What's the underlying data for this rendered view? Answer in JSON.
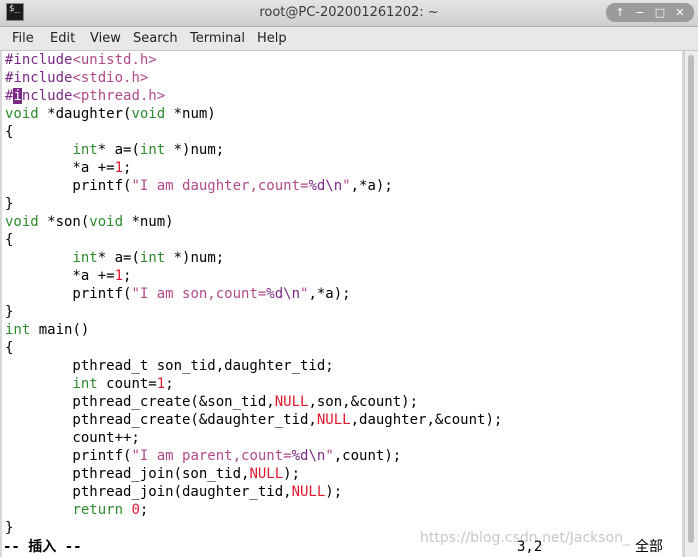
{
  "window": {
    "title": "root@PC-202001261202: ~",
    "app_icon_text": "$_",
    "controls": [
      "↑",
      "−",
      "□",
      "✕"
    ]
  },
  "menu": [
    "File",
    "Edit",
    "View",
    "Search",
    "Terminal",
    "Help"
  ],
  "code": [
    [
      [
        "pre",
        "#include"
      ],
      [
        "str",
        "<unistd.h>"
      ]
    ],
    [
      [
        "pre",
        "#include"
      ],
      [
        "str",
        "<stdio.h>"
      ]
    ],
    [
      [
        "pre",
        "#"
      ],
      [
        "cur",
        "i"
      ],
      [
        "pre",
        "nclude"
      ],
      [
        "str",
        "<pthread.h>"
      ]
    ],
    [
      [
        "kw",
        "void"
      ],
      [
        "n",
        " *daughter("
      ],
      [
        "kw",
        "void"
      ],
      [
        "n",
        " *num)"
      ]
    ],
    [
      [
        "n",
        "{"
      ]
    ],
    [
      [
        "n",
        "        "
      ],
      [
        "kw",
        "int"
      ],
      [
        "n",
        "* a=("
      ],
      [
        "kw",
        "int"
      ],
      [
        "n",
        " *)num;"
      ]
    ],
    [
      [
        "n",
        "        *a +="
      ],
      [
        "num",
        "1"
      ],
      [
        "n",
        ";"
      ]
    ],
    [
      [
        "n",
        "        printf("
      ],
      [
        "str",
        "\"I am daughter,count="
      ],
      [
        "pre",
        "%d\\n"
      ],
      [
        "str",
        "\""
      ],
      [
        "n",
        ",*a);"
      ]
    ],
    [
      [
        "n",
        "}"
      ]
    ],
    [
      [
        "kw",
        "void"
      ],
      [
        "n",
        " *son("
      ],
      [
        "kw",
        "void"
      ],
      [
        "n",
        " *num)"
      ]
    ],
    [
      [
        "n",
        "{"
      ]
    ],
    [
      [
        "n",
        "        "
      ],
      [
        "kw",
        "int"
      ],
      [
        "n",
        "* a=("
      ],
      [
        "kw",
        "int"
      ],
      [
        "n",
        " *)num;"
      ]
    ],
    [
      [
        "n",
        "        *a +="
      ],
      [
        "num",
        "1"
      ],
      [
        "n",
        ";"
      ]
    ],
    [
      [
        "n",
        "        printf("
      ],
      [
        "str",
        "\"I am son,count="
      ],
      [
        "pre",
        "%d\\n"
      ],
      [
        "str",
        "\""
      ],
      [
        "n",
        ",*a);"
      ]
    ],
    [
      [
        "n",
        "}"
      ]
    ],
    [
      [
        "kw",
        "int"
      ],
      [
        "n",
        " main()"
      ]
    ],
    [
      [
        "n",
        "{"
      ]
    ],
    [
      [
        "n",
        "        pthread_t son_tid,daughter_tid;"
      ]
    ],
    [
      [
        "n",
        "        "
      ],
      [
        "kw",
        "int"
      ],
      [
        "n",
        " count="
      ],
      [
        "num",
        "1"
      ],
      [
        "n",
        ";"
      ]
    ],
    [
      [
        "n",
        "        pthread_create(&son_tid,"
      ],
      [
        "num",
        "NULL"
      ],
      [
        "n",
        ",son,&count);"
      ]
    ],
    [
      [
        "n",
        "        pthread_create(&daughter_tid,"
      ],
      [
        "num",
        "NULL"
      ],
      [
        "n",
        ",daughter,&count);"
      ]
    ],
    [
      [
        "n",
        "        count++;"
      ]
    ],
    [
      [
        "n",
        "        printf("
      ],
      [
        "str",
        "\"I am parent,count="
      ],
      [
        "pre",
        "%d\\n"
      ],
      [
        "str",
        "\""
      ],
      [
        "n",
        ",count);"
      ]
    ],
    [
      [
        "n",
        "        pthread_join(son_tid,"
      ],
      [
        "num",
        "NULL"
      ],
      [
        "n",
        ");"
      ]
    ],
    [
      [
        "n",
        "        pthread_join(daughter_tid,"
      ],
      [
        "num",
        "NULL"
      ],
      [
        "n",
        ");"
      ]
    ],
    [
      [
        "n",
        "        "
      ],
      [
        "kw",
        "return"
      ],
      [
        "n",
        " "
      ],
      [
        "num",
        "0"
      ],
      [
        "n",
        ";"
      ]
    ],
    [
      [
        "n",
        "}"
      ]
    ]
  ],
  "status": {
    "mode": "-- 插入 --",
    "position": "3,2",
    "scope": "全部"
  },
  "watermark": "https://blog.csdn.net/Jackson_"
}
